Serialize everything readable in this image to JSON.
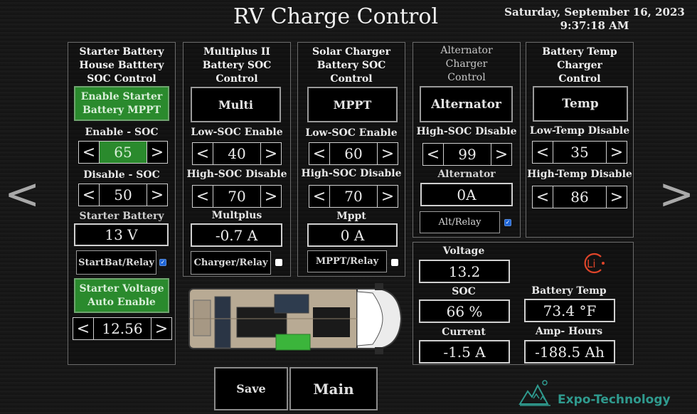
{
  "header": {
    "title": "RV Charge Control",
    "date": "Saturday, September 16, 2023",
    "time": "9:37:18 AM"
  },
  "nav": {
    "prev": "<",
    "next": ">"
  },
  "starter": {
    "title": "Starter Battery House Batttery SOC Control",
    "title_lines": [
      "Starter Battery",
      "House Batttery",
      "SOC Control"
    ],
    "enable_button_lines": [
      "Enable Starter",
      "Battery MPPT"
    ],
    "enable_soc_label": "Enable - SOC",
    "enable_soc_value": "65",
    "disable_soc_label": "Disable - SOC",
    "disable_soc_value": "50",
    "battery_label": "Starter Battery",
    "battery_value": "13 V",
    "relay_label": "StartBat/Relay",
    "relay_checked": true,
    "auto_button_lines": [
      "Starter Voltage",
      "Auto Enable"
    ],
    "auto_voltage_value": "12.56"
  },
  "multiplus": {
    "title_lines": [
      "Multiplus II",
      "Battery SOC",
      "Control"
    ],
    "button_label": "Multi",
    "low_label": "Low-SOC Enable",
    "low_value": "40",
    "high_label": "High-SOC Disable",
    "high_value": "70",
    "reading_label": "Multplus",
    "reading_value": "-0.7 A",
    "relay_label": "Charger/Relay",
    "relay_checked": false
  },
  "solar": {
    "title_lines": [
      "Solar Charger",
      "Battery SOC",
      "Control"
    ],
    "button_label": "MPPT",
    "low_label": "Low-SOC Enable",
    "low_value": "60",
    "high_label": "High-SOC Disable",
    "high_value": "70",
    "reading_label": "Mppt",
    "reading_value": "0 A",
    "relay_label": "MPPT/Relay",
    "relay_checked": false
  },
  "alternator": {
    "title_lines": [
      "Alternator",
      "Charger",
      "Control"
    ],
    "button_label": "Alternator",
    "high_label": "High-SOC Disable",
    "high_value": "99",
    "reading_label": "Alternator",
    "reading_value": "0A",
    "relay_label": "Alt/Relay",
    "relay_checked": true
  },
  "temp": {
    "title_lines": [
      "Battery Temp",
      "Charger",
      "Control"
    ],
    "button_label": "Temp",
    "low_label": "Low-Temp Disable",
    "low_value": "35",
    "high_label": "High-Temp Disable",
    "high_value": "86"
  },
  "battery": {
    "logo_text": "Li",
    "voltage_label": "Voltage",
    "voltage_value": "13.2",
    "soc_label": "SOC",
    "soc_value": "66 %",
    "temp_label": "Battery Temp",
    "temp_value": "73.4 °F",
    "current_label": "Current",
    "current_value": "-1.5 A",
    "ah_label": "Amp- Hours",
    "ah_value": "-188.5 Ah"
  },
  "footer": {
    "save_label": "Save",
    "main_label": "Main",
    "brand": "Expo-Technology"
  },
  "colors": {
    "accent_green": "#2a8a2d",
    "checkbox_blue": "#1e64d6",
    "brand_teal": "#2f9a8e",
    "lithium_red": "#e0452a"
  },
  "icons": {
    "nav_prev": "chevron-left-icon",
    "nav_next": "chevron-right-icon",
    "lithium": "lithium-battery-icon",
    "brand": "mountain-logo-icon",
    "van": "van-top-view-image"
  }
}
